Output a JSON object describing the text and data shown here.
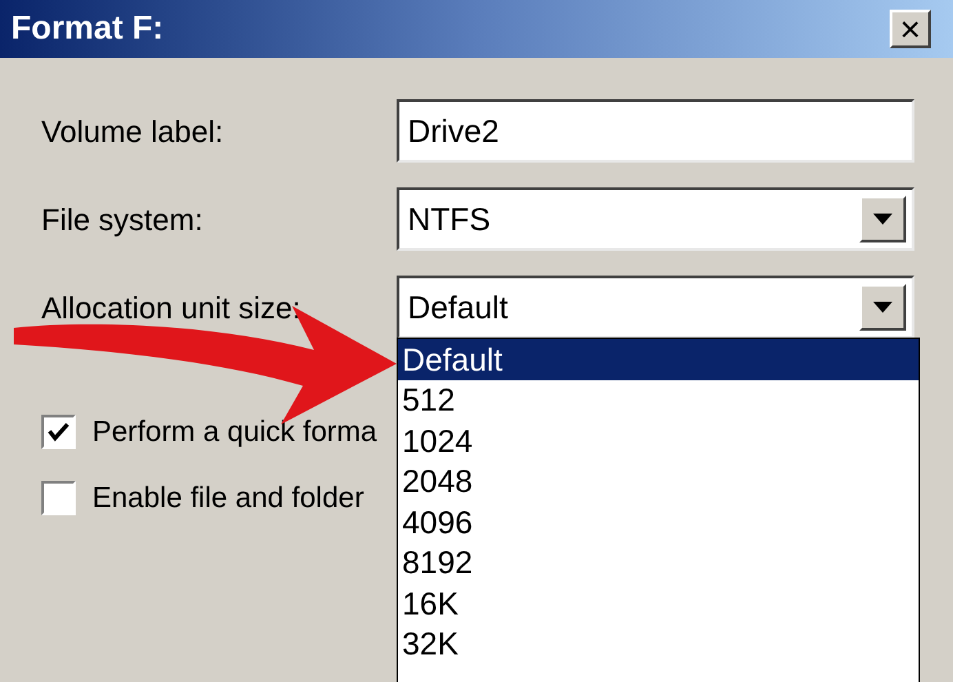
{
  "window": {
    "title": "Format F:",
    "close": "×"
  },
  "fields": [
    {
      "kind": "text",
      "label": "Volume label:",
      "value": "Drive2"
    },
    {
      "kind": "combo",
      "label": "File system:",
      "value": "NTFS"
    },
    {
      "kind": "combo",
      "label": "Allocation unit size:",
      "value": "Default"
    }
  ],
  "checkboxes": [
    {
      "label": "Perform a quick forma",
      "checked": true
    },
    {
      "label": "Enable file and folder",
      "checked": false
    }
  ],
  "dropdown_list": [
    {
      "label": "Default",
      "selected": true
    },
    {
      "label": "512",
      "selected": false
    },
    {
      "label": "1024",
      "selected": false
    },
    {
      "label": "2048",
      "selected": false
    },
    {
      "label": "4096",
      "selected": false
    },
    {
      "label": "8192",
      "selected": false
    },
    {
      "label": "16K",
      "selected": false
    },
    {
      "label": "32K",
      "selected": false
    }
  ]
}
